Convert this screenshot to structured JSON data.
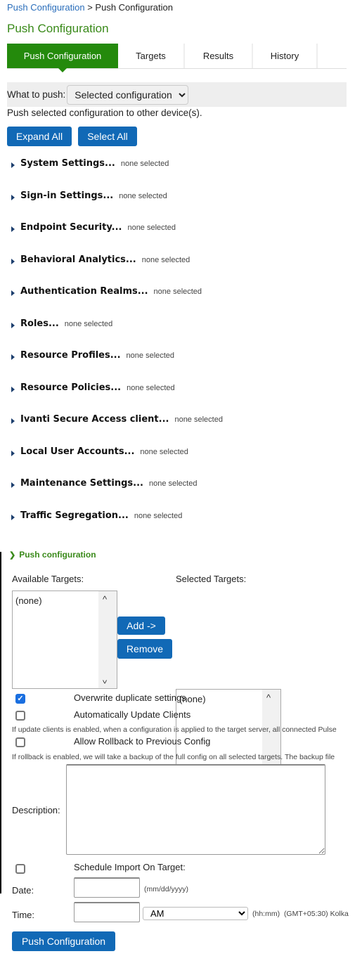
{
  "breadcrumb": {
    "link": "Push Configuration",
    "separator": ">",
    "current": "Push Configuration"
  },
  "page_title": "Push Configuration",
  "tabs": [
    {
      "label": "Push Configuration",
      "active": true
    },
    {
      "label": "Targets"
    },
    {
      "label": "Results"
    },
    {
      "label": "History"
    }
  ],
  "what_to_push": {
    "label": "What to push:",
    "value": "Selected configuration"
  },
  "description_text": "Push selected configuration to other device(s).",
  "buttons": {
    "expand_all": "Expand All",
    "select_all": "Select All",
    "add": "Add ->",
    "remove": "Remove",
    "push": "Push Configuration"
  },
  "sections": [
    {
      "label": "System Settings...",
      "status": "none selected"
    },
    {
      "label": "Sign-in Settings...",
      "status": "none selected"
    },
    {
      "label": "Endpoint Security...",
      "status": "none selected"
    },
    {
      "label": "Behavioral Analytics...",
      "status": "none selected"
    },
    {
      "label": "Authentication Realms...",
      "status": "none selected"
    },
    {
      "label": "Roles...",
      "status": "none selected"
    },
    {
      "label": "Resource Profiles...",
      "status": "none selected"
    },
    {
      "label": "Resource Policies...",
      "status": "none selected"
    },
    {
      "label": "Ivanti Secure Access client...",
      "status": "none selected"
    },
    {
      "label": "Local User Accounts...",
      "status": "none selected"
    },
    {
      "label": "Maintenance Settings...",
      "status": "none selected"
    },
    {
      "label": "Traffic Segregation...",
      "status": "none selected"
    }
  ],
  "push_section": {
    "label": "Push configuration",
    "available_label": "Available Targets:",
    "available_value": "(none)",
    "selected_label": "Selected Targets:",
    "selected_value": "(none)",
    "overwrite": {
      "label": "Overwrite duplicate settings",
      "checked": true
    },
    "auto_update": {
      "label": "Automatically Update Clients",
      "checked": false,
      "note": "If update clients is enabled, when a configuration is applied to the target server, all connected Pulse"
    },
    "rollback": {
      "label": "Allow Rollback to Previous Config",
      "checked": false,
      "note": "If rollback is enabled, we will take a backup of the full config on all selected targets. The backup file"
    },
    "description_label": "Description:",
    "description_value": "",
    "schedule": {
      "label": "Schedule Import On Target:",
      "checked": false
    },
    "date_label": "Date:",
    "date_hint": "(mm/dd/yyyy)",
    "time_label": "Time:",
    "ampm": "AM",
    "time_hint": "(hh:mm)",
    "timezone": "(GMT+05:30) Kolka"
  },
  "colors": {
    "accent_green": "#248a0c",
    "button_blue": "#1169b6",
    "link": "#2a6ebb"
  }
}
